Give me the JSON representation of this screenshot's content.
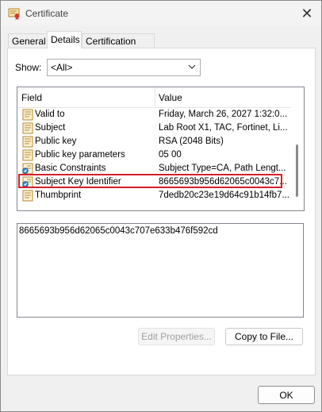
{
  "window": {
    "title": "Certificate",
    "close_glyph": "✕"
  },
  "tabs": [
    {
      "label": "General"
    },
    {
      "label": "Details"
    },
    {
      "label": "Certification Path"
    }
  ],
  "active_tab": "Details",
  "show": {
    "label": "Show:",
    "selected": "<All>"
  },
  "list": {
    "columns": {
      "field": "Field",
      "value": "Value"
    },
    "rows": [
      {
        "field": "Valid to",
        "value": "Friday, March 26, 2027 1:32:0...",
        "icon": "certificate-field-icon"
      },
      {
        "field": "Subject",
        "value": "Lab Root X1, TAC, Fortinet, Li...",
        "icon": "certificate-field-icon"
      },
      {
        "field": "Public key",
        "value": "RSA (2048 Bits)",
        "icon": "certificate-field-icon"
      },
      {
        "field": "Public key parameters",
        "value": "05 00",
        "icon": "certificate-field-icon"
      },
      {
        "field": "Basic Constraints",
        "value": "Subject Type=CA, Path Lengt...",
        "icon": "certificate-extension-icon"
      },
      {
        "field": "Subject Key Identifier",
        "value": "8665693b956d62065c0043c7...",
        "icon": "certificate-extension-icon"
      },
      {
        "field": "Thumbprint",
        "value": "7dedb20c23e19d64c91b14fb7...",
        "icon": "certificate-field-icon"
      }
    ],
    "selected_field": "Subject Key Identifier"
  },
  "value_box": {
    "text": "8665693b956d62065c0043c707e633b476f592cd"
  },
  "buttons": {
    "edit_properties": "Edit Properties...",
    "copy_to_file": "Copy to File...",
    "ok": "OK"
  },
  "colors": {
    "highlight_border": "#d41f28",
    "icon_gold": "#c8a040"
  }
}
